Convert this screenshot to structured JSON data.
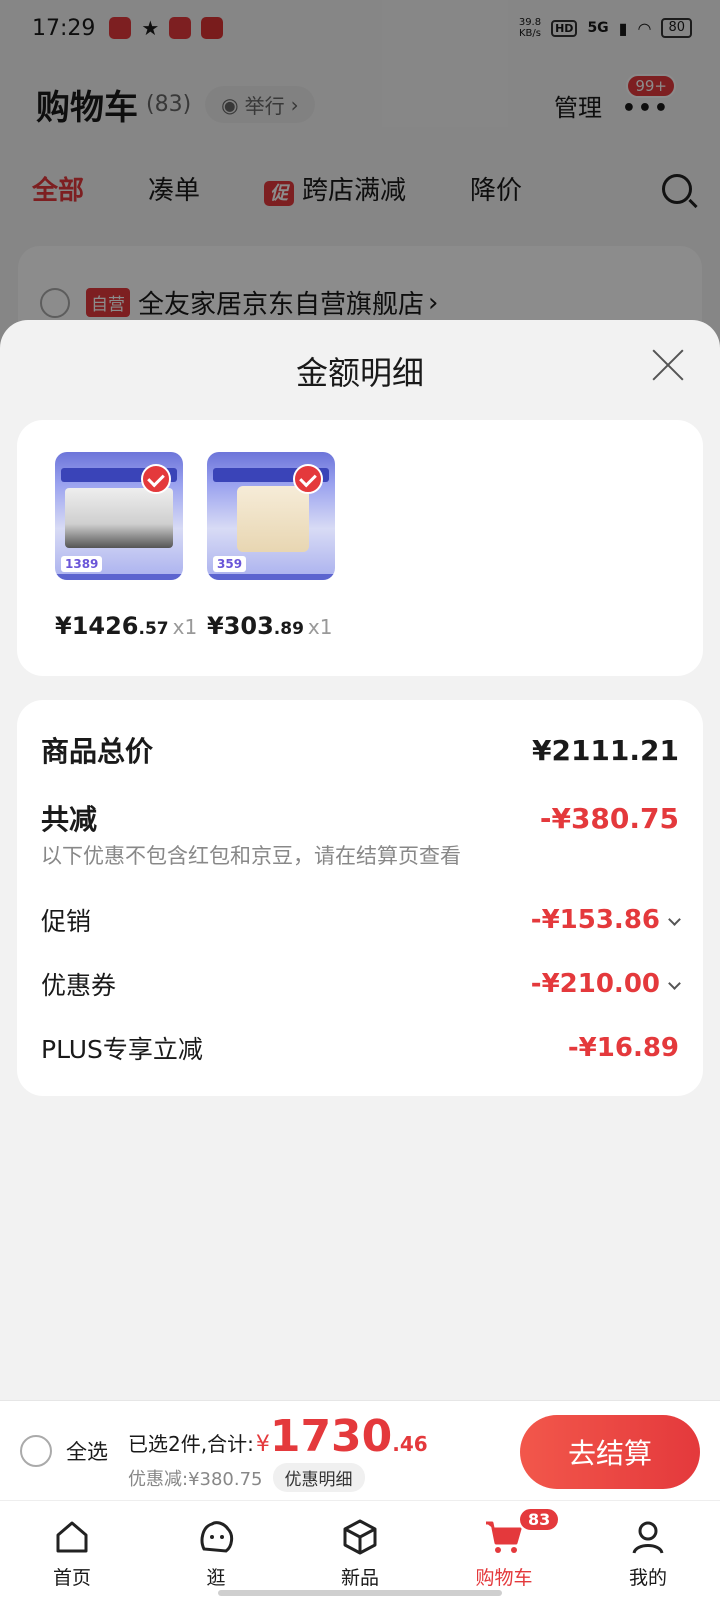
{
  "status_bar": {
    "time": "17:29",
    "net_speed_value": "39.8",
    "net_speed_unit": "KB/s",
    "hd_label": "HD",
    "signal_label": "5G",
    "battery": "80"
  },
  "cart_page": {
    "title": "购物车",
    "count": "(83)",
    "report_label": "举行",
    "manage_label": "管理",
    "more_badge": "99+",
    "tabs": [
      {
        "label": "全部"
      },
      {
        "label": "凑单"
      },
      {
        "label": "跨店满减",
        "tag": "促"
      },
      {
        "label": "降价"
      }
    ],
    "store": {
      "tag": "自营",
      "name": "全友家居京东自营旗舰店"
    }
  },
  "sheet": {
    "title": "金额明细",
    "products": [
      {
        "thumb_price": "1389",
        "price_int": "¥1426",
        "price_dec": ".57",
        "qty": "x1"
      },
      {
        "thumb_price": "359",
        "price_int": "¥303",
        "price_dec": ".89",
        "qty": "x1"
      }
    ],
    "summary": {
      "total_label": "商品总价",
      "total_value": "¥2111.21",
      "reduce_label": "共减",
      "reduce_value": "-¥380.75",
      "note": "以下优惠不包含红包和京豆，请在结算页查看",
      "promo_label": "促销",
      "promo_value": "-¥153.86",
      "coupon_label": "优惠券",
      "coupon_value": "-¥210.00",
      "plus_label": "PLUS专享立减",
      "plus_value": "-¥16.89"
    }
  },
  "bottom_bar": {
    "select_all": "全选",
    "selected_text": "已选2件,合计:",
    "currency": "¥",
    "total_int": "1730",
    "total_dec": ".46",
    "discount_text": "优惠减:¥380.75",
    "detail_label": "优惠明细",
    "checkout_label": "去结算"
  },
  "tab_bar": {
    "items": [
      {
        "label": "首页",
        "icon": "home-icon"
      },
      {
        "label": "逛",
        "icon": "browse-icon"
      },
      {
        "label": "新品",
        "icon": "new-products-icon"
      },
      {
        "label": "购物车",
        "icon": "cart-icon",
        "badge": "83"
      },
      {
        "label": "我的",
        "icon": "profile-icon"
      }
    ]
  },
  "colors": {
    "accent": "#e4393c"
  }
}
